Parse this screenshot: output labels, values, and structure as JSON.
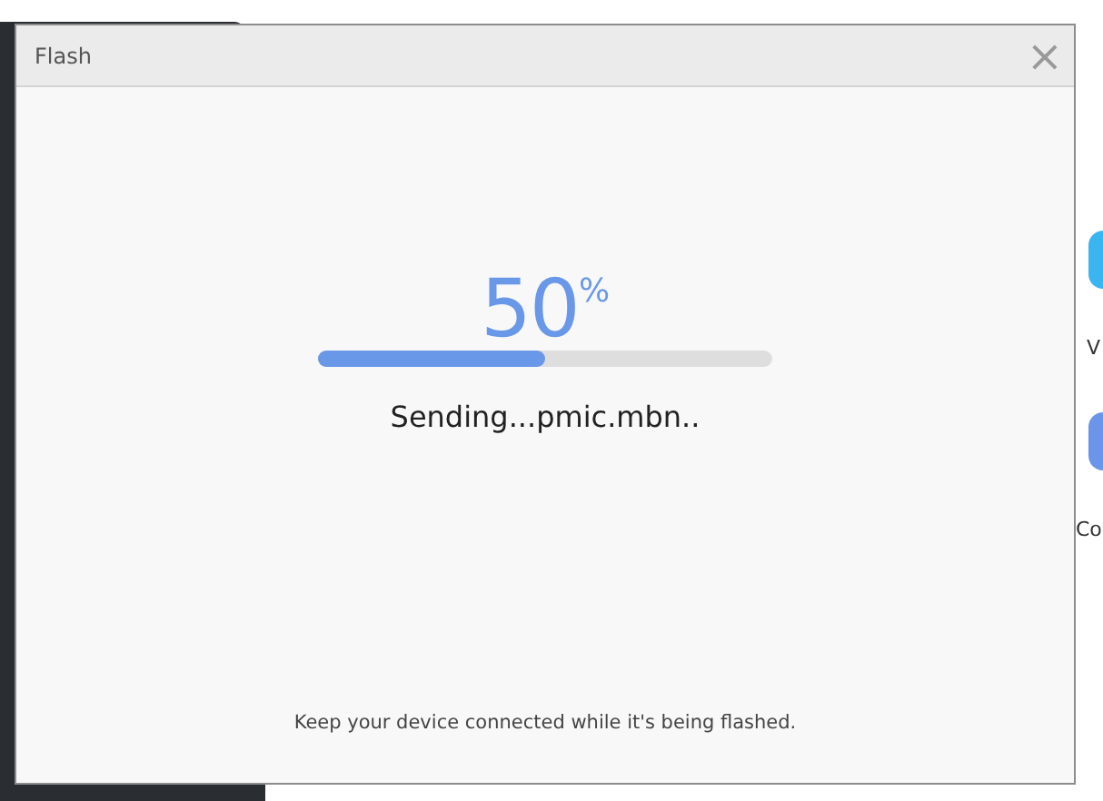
{
  "background": {
    "labels": [
      "V",
      "Co"
    ]
  },
  "window": {
    "title": "Flash",
    "close": "×"
  },
  "progress": {
    "percent": "50",
    "unit": "%",
    "level": 0.5,
    "status": "Sending...pmic.mbn.."
  },
  "footer": "Keep your device connected while it's being flashed."
}
